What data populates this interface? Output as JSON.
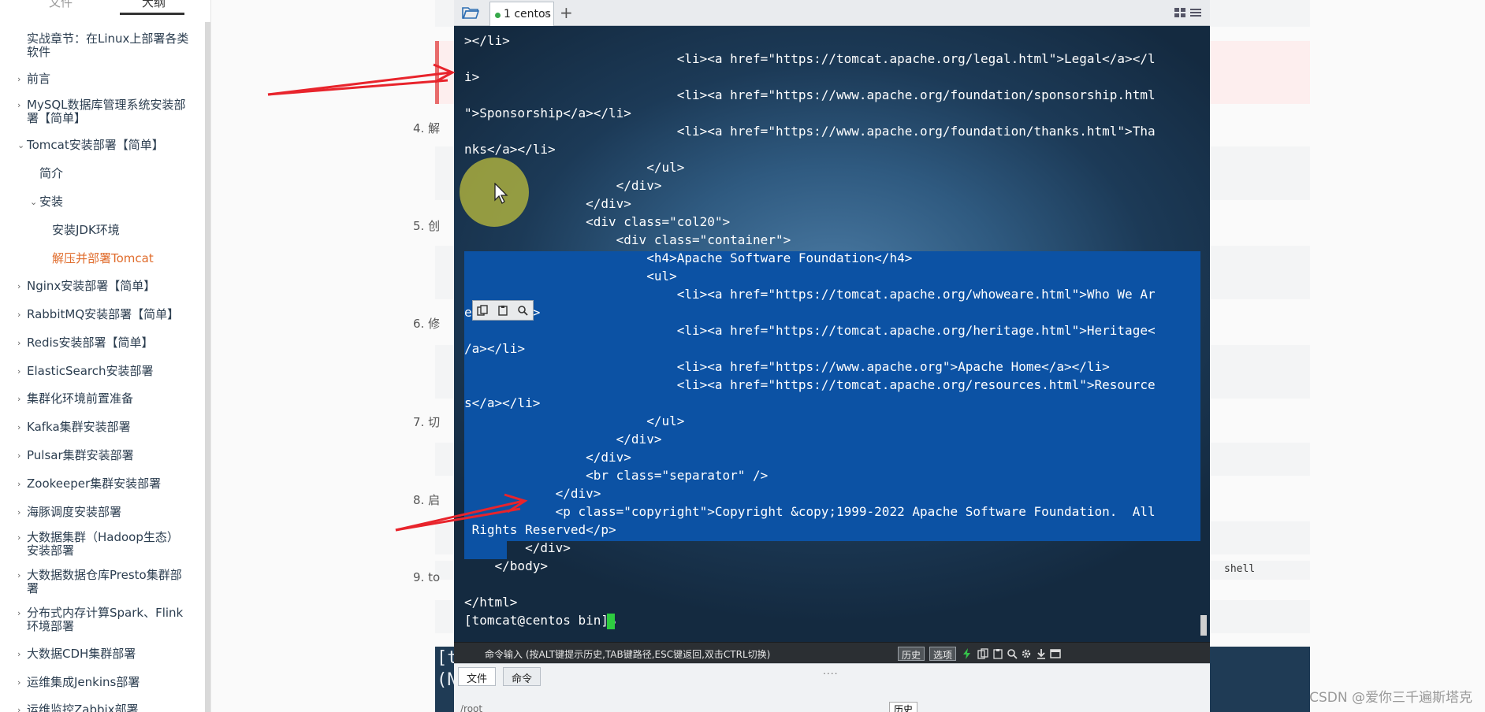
{
  "sidebar": {
    "tabs": [
      "文件",
      "大纲"
    ],
    "items": [
      {
        "label": "实战章节：在Linux上部署各类软件",
        "arrow": ""
      },
      {
        "label": "前言",
        "arrow": "›"
      },
      {
        "label": "MySQL数据库管理系统安装部署【简单】",
        "arrow": "›"
      },
      {
        "label": "Tomcat安装部署【简单】",
        "arrow": "⌄"
      },
      {
        "label": "简介",
        "arrow": ""
      },
      {
        "label": "安装",
        "arrow": "⌄"
      },
      {
        "label": "安装JDK环境",
        "arrow": ""
      },
      {
        "label": "解压并部署Tomcat",
        "arrow": ""
      },
      {
        "label": "Nginx安装部署【简单】",
        "arrow": "›"
      },
      {
        "label": "RabbitMQ安装部署【简单】",
        "arrow": "›"
      },
      {
        "label": "Redis安装部署【简单】",
        "arrow": "›"
      },
      {
        "label": "ElasticSearch安装部署",
        "arrow": "›"
      },
      {
        "label": "集群化环境前置准备",
        "arrow": "›"
      },
      {
        "label": "Kafka集群安装部署",
        "arrow": "›"
      },
      {
        "label": "Pulsar集群安装部署",
        "arrow": "›"
      },
      {
        "label": "Zookeeper集群安装部署",
        "arrow": "›"
      },
      {
        "label": "海豚调度安装部署",
        "arrow": "›"
      },
      {
        "label": "大数据集群（Hadoop生态）安装部署",
        "arrow": "›"
      },
      {
        "label": "大数据数据仓库Presto集群部署",
        "arrow": "›"
      },
      {
        "label": "分布式内存计算Spark、Flink环境部署",
        "arrow": "›"
      },
      {
        "label": "大数据CDH集群部署",
        "arrow": "›"
      },
      {
        "label": "运维集成Jenkins部署",
        "arrow": "›"
      },
      {
        "label": "运维监控Zabbix部署",
        "arrow": "›"
      }
    ]
  },
  "content": {
    "steps": [
      "4. 解",
      "5. 创",
      "6. 修",
      "7. 切",
      "8. 启",
      "9. to"
    ],
    "shell_label": "shell",
    "dark_output": [
      "[t",
      "(N"
    ],
    "watermark": "CSDN @爱你三千遍斯塔克"
  },
  "terminal": {
    "tab_label": "1 centos",
    "tab_close": "×",
    "new_tab": "+",
    "lines": [
      "></li>",
      "                            <li><a href=\"https://tomcat.apache.org/legal.html\">Legal</a></l",
      "i>",
      "                            <li><a href=\"https://www.apache.org/foundation/sponsorship.html",
      "\">Sponsorship</a></li>",
      "                            <li><a href=\"https://www.apache.org/foundation/thanks.html\">Tha",
      "nks</a></li>",
      "                        </ul>",
      "                    </div>",
      "                </div>",
      "                <div class=\"col20\">",
      "                    <div class=\"container\">",
      "                        <h4>Apache Software Foundation</h4>",
      "                        <ul>",
      "                            <li><a href=\"https://tomcat.apache.org/whoweare.html\">Who We Ar",
      "e</a></li>",
      "                            <li><a href=\"https://tomcat.apache.org/heritage.html\">Heritage<",
      "/a></li>",
      "                            <li><a href=\"https://www.apache.org\">Apache Home</a></li>",
      "                            <li><a href=\"https://tomcat.apache.org/resources.html\">Resource",
      "s</a></li>",
      "                        </ul>",
      "                    </div>",
      "                </div>",
      "                <br class=\"separator\" />",
      "            </div>",
      "            <p class=\"copyright\">Copyright &copy;1999-2022 Apache Software Foundation.  All",
      " Rights Reserved</p>",
      "        </div>",
      "    </body>",
      "",
      "</html>",
      "[tomcat@centos bin]$ "
    ],
    "cmd_hint": "命令输入 (按ALT键提示历史,TAB键路径,ESC键返回,双击CTRL切换)",
    "cmd_history_btn": "历史",
    "cmd_options_btn": "选项",
    "bottom_tabs": [
      "文件",
      "命令"
    ],
    "path": "/root",
    "path_history_btn": "历史",
    "dotted": "....",
    "colors": {
      "selection": "#0c52a4",
      "cursor": "#2ecc40",
      "tab_dot": "#37a84a"
    }
  }
}
